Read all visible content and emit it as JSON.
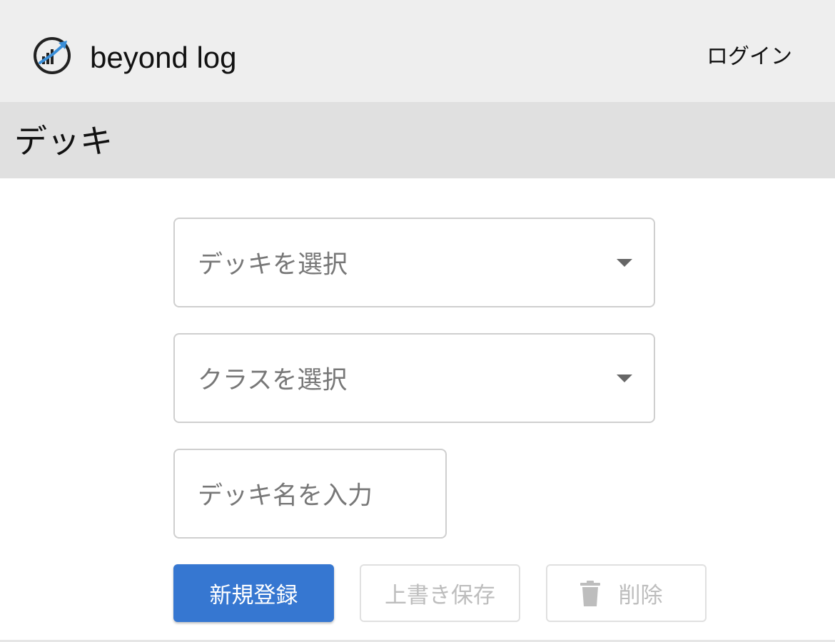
{
  "header": {
    "brand": "beyond log",
    "login": "ログイン"
  },
  "page": {
    "title": "デッキ"
  },
  "form": {
    "deck_select": {
      "placeholder": "デッキを選択"
    },
    "class_select": {
      "placeholder": "クラスを選択"
    },
    "deck_name": {
      "placeholder": "デッキ名を入力"
    }
  },
  "actions": {
    "register": "新規登録",
    "overwrite": "上書き保存",
    "delete": "削除"
  },
  "icons": {
    "logo": "chart-growth-logo-icon",
    "dropdown": "caret-down-icon",
    "delete": "trash-icon"
  },
  "colors": {
    "header_bg": "#eeeeee",
    "title_bar_bg": "#e0e0e0",
    "primary": "#3677d1",
    "logo_accent": "#3a8fd9",
    "disabled_text": "#bdbdbd"
  }
}
